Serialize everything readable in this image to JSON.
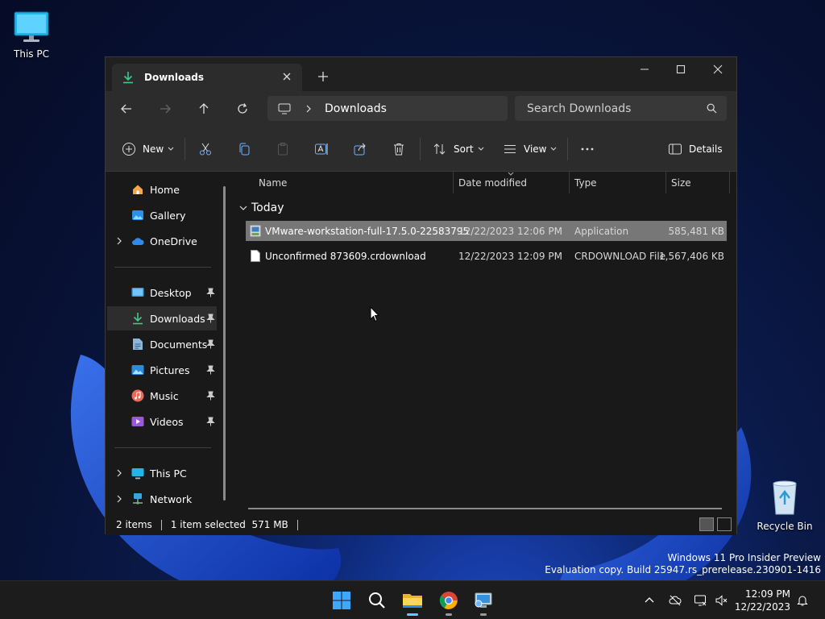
{
  "desktop": {
    "icons": [
      {
        "label": "This PC"
      },
      {
        "label": "Recycle Bin"
      }
    ],
    "watermark": {
      "line1": "Windows 11 Pro Insider Preview",
      "line2": "Evaluation copy. Build 25947.rs_prerelease.230901-1416"
    }
  },
  "window": {
    "tab_title": "Downloads",
    "address": {
      "location": "Downloads"
    },
    "search": {
      "placeholder": "Search Downloads"
    },
    "toolbar": {
      "new_label": "New",
      "sort_label": "Sort",
      "view_label": "View",
      "details_label": "Details"
    },
    "nav": {
      "items": [
        {
          "label": "Home"
        },
        {
          "label": "Gallery"
        },
        {
          "label": "OneDrive"
        },
        {
          "label": "Desktop"
        },
        {
          "label": "Downloads"
        },
        {
          "label": "Documents"
        },
        {
          "label": "Pictures"
        },
        {
          "label": "Music"
        },
        {
          "label": "Videos"
        },
        {
          "label": "This PC"
        },
        {
          "label": "Network"
        }
      ],
      "selected": "Downloads"
    },
    "columns": [
      "Name",
      "Date modified",
      "Type",
      "Size"
    ],
    "group": "Today",
    "files": [
      {
        "name": "VMware-workstation-full-17.5.0-22583795",
        "date": "12/22/2023 12:06 PM",
        "type": "Application",
        "size": "585,481 KB",
        "selected": true
      },
      {
        "name": "Unconfirmed 873609.crdownload",
        "date": "12/22/2023 12:09 PM",
        "type": "CRDOWNLOAD File",
        "size": "1,567,406 KB",
        "selected": false
      }
    ],
    "status": {
      "count": "2 items",
      "selection": "1 item selected  571 MB"
    }
  },
  "taskbar": {
    "clock": {
      "time": "12:09 PM",
      "date": "12/22/2023"
    },
    "accent": "#60cdff"
  }
}
